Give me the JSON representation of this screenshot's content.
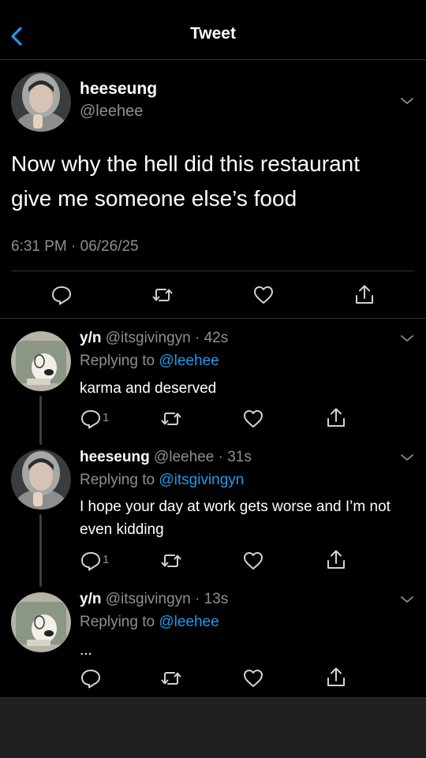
{
  "header": {
    "title": "Tweet"
  },
  "main_tweet": {
    "name": "heeseung",
    "handle": "@leehee",
    "text": "Now why the hell did this restaurant give me someone else’s food",
    "timestamp": "6:31 PM · 06/26/25"
  },
  "replies": [
    {
      "name": "y/n",
      "meta": "@itsgivingyn · 42s",
      "replying_prefix": "Replying to",
      "replying_handle": "@leehee",
      "text": "karma and deserved",
      "reply_count": "1"
    },
    {
      "name": "heeseung",
      "meta": "@leehee · 31s",
      "replying_prefix": "Replying to",
      "replying_handle": "@itsgivingyn",
      "text": "I hope your day at work gets worse and I’m not even kidding",
      "reply_count": "1"
    },
    {
      "name": "y/n",
      "meta": "@itsgivingyn · 13s",
      "replying_prefix": "Replying to",
      "replying_handle": "@leehee",
      "text": "...",
      "reply_count": ""
    }
  ],
  "colors": {
    "background": "#000000",
    "accent": "#1d9bf0",
    "muted": "#8b8f94",
    "divider": "#2f3336"
  },
  "icons": [
    "back-chevron-icon",
    "chevron-down-icon",
    "reply-icon",
    "retweet-icon",
    "like-icon",
    "share-icon"
  ]
}
